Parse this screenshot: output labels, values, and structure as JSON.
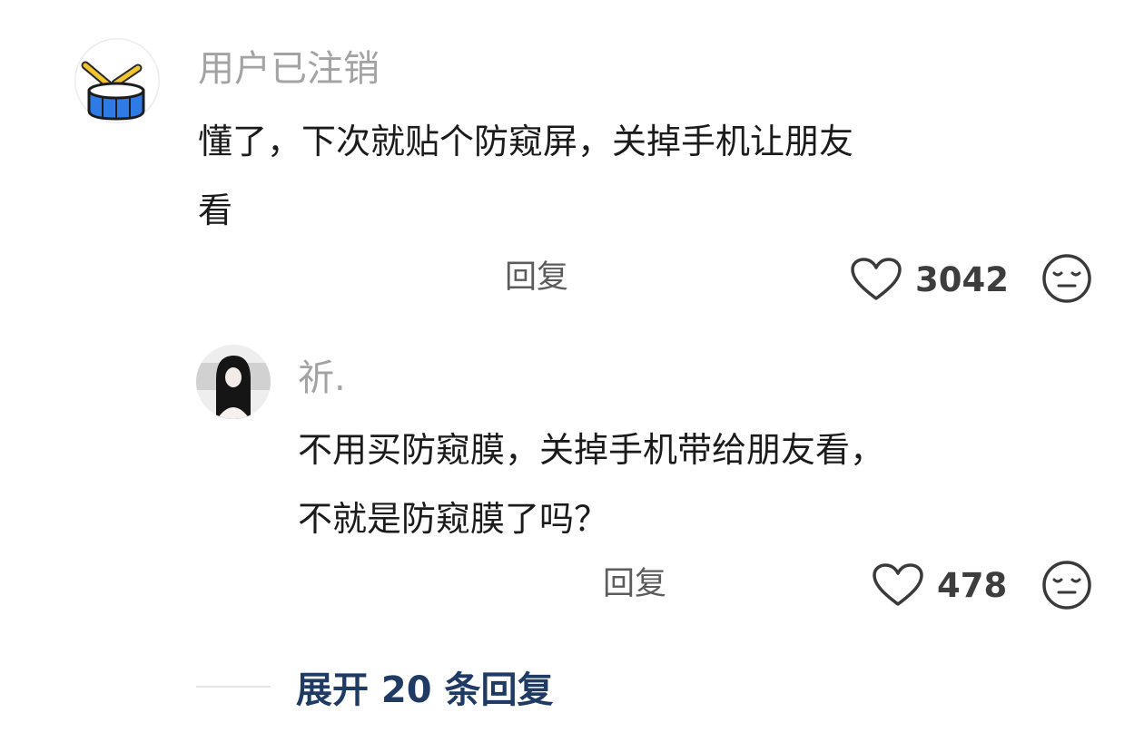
{
  "comment": {
    "username": "用户已注销",
    "text_line1": "懂了，下次就贴个防窥屏，关掉手机让朋友",
    "text_line2": "看",
    "reply_label": "回复",
    "like_count": "3042"
  },
  "reply": {
    "username": "祈.",
    "text_line1": "不用买防窥膜，关掉手机带给朋友看，",
    "text_line2": "不就是防窥膜了吗？",
    "reply_label": "回复",
    "like_count": "478"
  },
  "expand": {
    "label": "展开 20 条回复"
  },
  "colors": {
    "username": "#a3a3a3",
    "text": "#1b1b1b",
    "expand": "#1f3a63",
    "drum_blue": "#2e7be6",
    "drum_stick": "#f2c62f"
  }
}
